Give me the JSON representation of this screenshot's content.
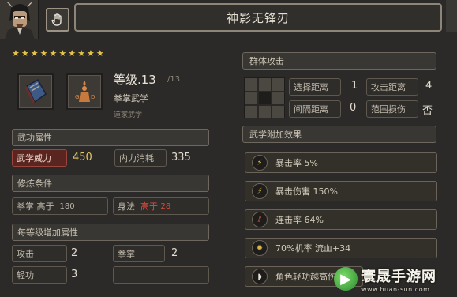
{
  "header": {
    "title": "神影无锋刃",
    "hand_icon": "hand-icon",
    "portrait_icon": "character-portrait"
  },
  "stars": {
    "count": 10,
    "color": "#e4c44a"
  },
  "skill": {
    "book_icon": "book-icon",
    "emblem_icon": "school-emblem-icon",
    "level_label": "等级.13",
    "level_max": "/13",
    "school": "拳掌武学",
    "subschool": "道家武学"
  },
  "attributes": {
    "header": "武功属性",
    "power_label": "武学威力",
    "power_value": "450",
    "cost_label": "内力消耗",
    "cost_value": "335"
  },
  "requirements": {
    "header": "修炼条件",
    "req1_label": "拳掌",
    "req1_cond": "高于",
    "req1_value": "180",
    "req2_label": "身法",
    "req2_cond": "高于",
    "req2_value": "28"
  },
  "per_level": {
    "header": "每等级增加属性",
    "items": [
      {
        "label": "攻击",
        "value": "2"
      },
      {
        "label": "拳掌",
        "value": "2"
      },
      {
        "label": "轻功",
        "value": "3"
      },
      {
        "label": "",
        "value": ""
      }
    ]
  },
  "attack": {
    "header": "群体攻击",
    "grid_icon": "area-grid-icon",
    "stats": [
      {
        "label": "选择距离",
        "value": "1"
      },
      {
        "label": "攻击距离",
        "value": "4"
      },
      {
        "label": "间隔距离",
        "value": "0"
      },
      {
        "label": "范围损伤",
        "value": "否"
      }
    ]
  },
  "effects": {
    "header": "武学附加效果",
    "items": [
      {
        "label": "暴击率 5%",
        "icon": "lightning-icon"
      },
      {
        "label": "暴击伤害 150%",
        "icon": "lightning-icon"
      },
      {
        "label": "连击率 64%",
        "icon": "slash-icon"
      },
      {
        "label": "70%机率 流血+34",
        "icon": "blood-icon"
      },
      {
        "label": "角色轻功越高伤",
        "icon": "boot-icon"
      }
    ]
  },
  "watermark": {
    "name": "寰晟手游网",
    "url": "www.huan-sun.com"
  },
  "colors": {
    "accent_gold": "#e7c85e",
    "highlight_red": "#5a2521",
    "warning_text": "#e04a3c"
  }
}
